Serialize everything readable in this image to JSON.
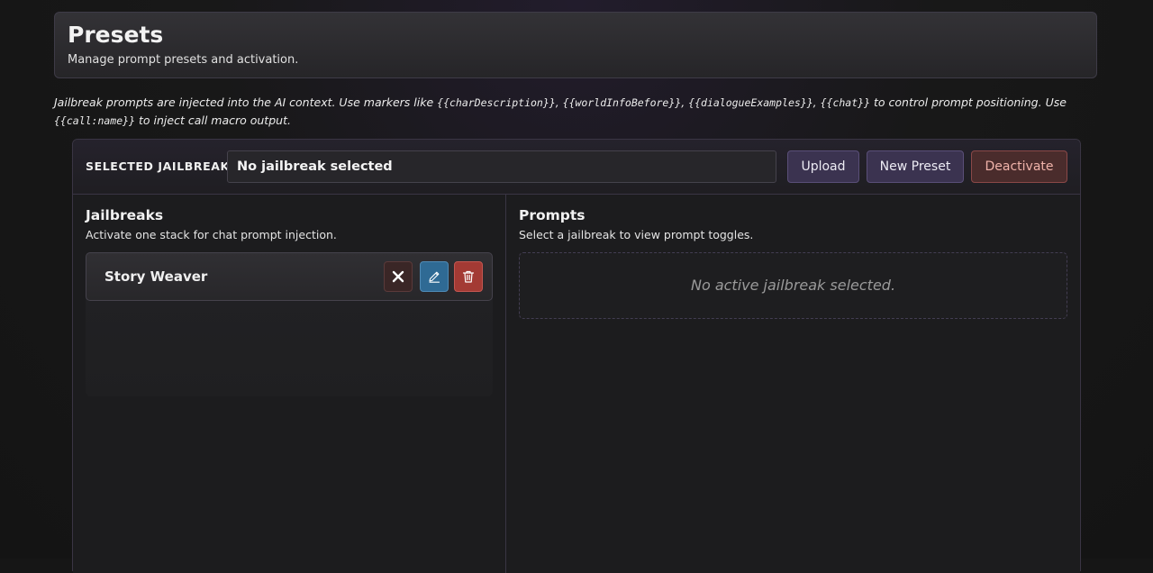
{
  "header": {
    "title": "Presets",
    "subtitle": "Manage prompt presets and activation."
  },
  "notice": {
    "part1": "Jailbreak prompts are injected into the AI context. Use markers like ",
    "m1": "{{charDescription}}",
    "sep1": ", ",
    "m2": "{{worldInfoBefore}}",
    "sep2": ", ",
    "m3": "{{dialogueExamples}}",
    "sep3": ", ",
    "m4": "{{chat}}",
    "part2": " to control prompt positioning. Use ",
    "m5": "{{call:name}}",
    "part3": " to inject call macro output."
  },
  "toolbar": {
    "selected_label": "SELECTED JAILBREAK",
    "selected_value": "No jailbreak selected",
    "upload_label": "Upload",
    "new_preset_label": "New Preset",
    "deactivate_label": "Deactivate"
  },
  "jailbreaks": {
    "title": "Jailbreaks",
    "subtitle": "Activate one stack for chat prompt injection.",
    "items": [
      {
        "name": "Story Weaver"
      }
    ]
  },
  "prompts": {
    "title": "Prompts",
    "subtitle": "Select a jailbreak to view prompt toggles.",
    "empty_text": "No active jailbreak selected."
  },
  "icons": {
    "close": "close-icon",
    "edit": "pencil-icon",
    "delete": "trash-icon"
  },
  "colors": {
    "accent": "#3b3350",
    "edit": "#2f6a94",
    "danger": "#a33a34"
  }
}
